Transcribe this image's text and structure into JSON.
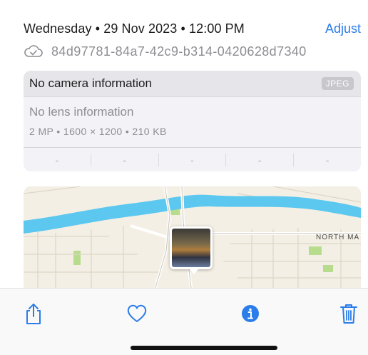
{
  "header": {
    "date_time": "Wednesday • 29 Nov 2023 • 12:00 PM",
    "adjust_label": "Adjust",
    "filename": "84d97781-84a7-42c9-b314-0420628d7340"
  },
  "camera_card": {
    "camera": "No camera information",
    "format_badge": "JPEG",
    "lens": "No lens information",
    "details": "2 MP  •  1600 × 1200  •  210 KB",
    "specs": [
      "-",
      "-",
      "-",
      "-",
      "-"
    ]
  },
  "map": {
    "street_label": "NORTH MA"
  },
  "toolbar": {
    "share": "share-icon",
    "favorite": "heart-icon",
    "info": "info-icon",
    "delete": "trash-icon"
  },
  "colors": {
    "accent": "#2b7de9",
    "river": "#5cc8f0",
    "park": "#b7dc8e"
  }
}
